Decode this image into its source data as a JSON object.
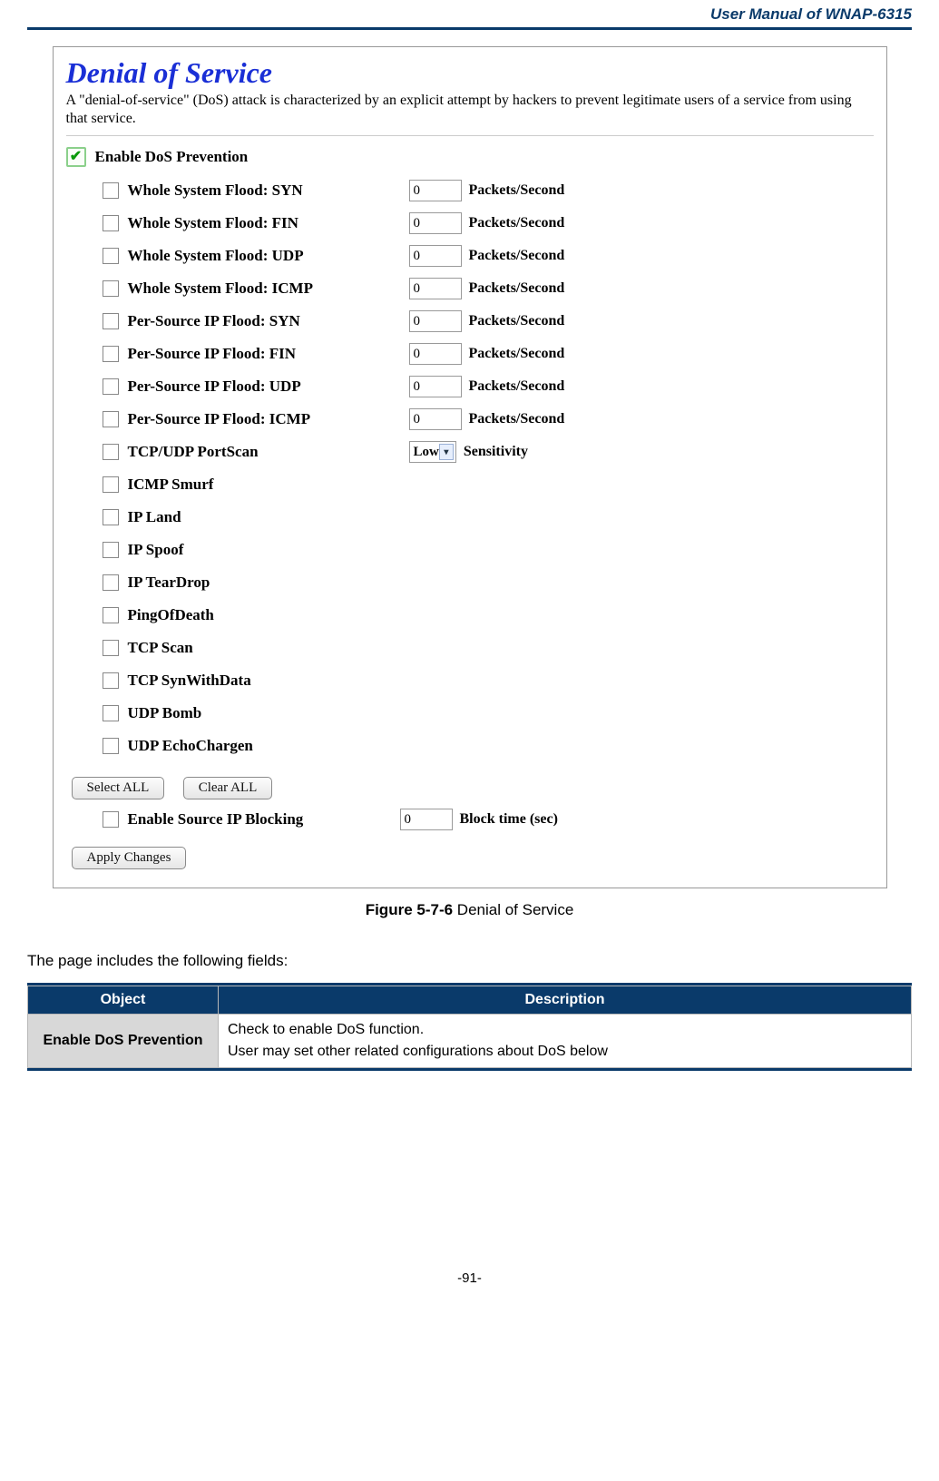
{
  "header": {
    "doc_title": "User Manual of WNAP-6315"
  },
  "panel": {
    "title": "Denial of Service",
    "desc": "A \"denial-of-service\" (DoS) attack is characterized by an explicit attempt by hackers to prevent legitimate users of a service from using that service.",
    "enable_label": "Enable DoS Prevention",
    "items": [
      {
        "label": "Whole System Flood: SYN",
        "value": "0",
        "unit": "Packets/Second"
      },
      {
        "label": "Whole System Flood: FIN",
        "value": "0",
        "unit": "Packets/Second"
      },
      {
        "label": "Whole System Flood: UDP",
        "value": "0",
        "unit": "Packets/Second"
      },
      {
        "label": "Whole System Flood: ICMP",
        "value": "0",
        "unit": "Packets/Second"
      },
      {
        "label": "Per-Source IP Flood: SYN",
        "value": "0",
        "unit": "Packets/Second"
      },
      {
        "label": "Per-Source IP Flood: FIN",
        "value": "0",
        "unit": "Packets/Second"
      },
      {
        "label": "Per-Source IP Flood: UDP",
        "value": "0",
        "unit": "Packets/Second"
      },
      {
        "label": "Per-Source IP Flood: ICMP",
        "value": "0",
        "unit": "Packets/Second"
      },
      {
        "label": "TCP/UDP PortScan",
        "select": "Low",
        "unit": "Sensitivity"
      },
      {
        "label": "ICMP Smurf"
      },
      {
        "label": "IP Land"
      },
      {
        "label": "IP Spoof"
      },
      {
        "label": "IP TearDrop"
      },
      {
        "label": "PingOfDeath"
      },
      {
        "label": "TCP Scan"
      },
      {
        "label": "TCP SynWithData"
      },
      {
        "label": "UDP Bomb"
      },
      {
        "label": "UDP EchoChargen"
      }
    ],
    "buttons": {
      "select_all": "Select ALL",
      "clear_all": "Clear ALL",
      "apply": "Apply Changes"
    },
    "source_block": {
      "label": "Enable Source IP Blocking",
      "value": "0",
      "unit": "Block time (sec)"
    }
  },
  "figure": {
    "num": "Figure 5-7-6",
    "caption": " Denial of Service"
  },
  "intro": "The page includes the following fields:",
  "table": {
    "head_object": "Object",
    "head_desc": "Description",
    "rows": [
      {
        "object": "Enable DoS Prevention",
        "desc": "Check to enable DoS function.\nUser may set other related configurations about DoS below"
      }
    ]
  },
  "footer": {
    "page": "-91-"
  }
}
